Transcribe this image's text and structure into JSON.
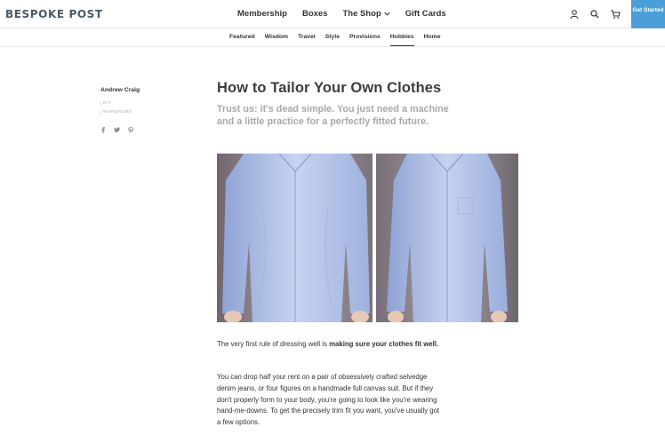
{
  "header": {
    "logo": "BESPOKE POST",
    "nav": [
      {
        "label": "Membership"
      },
      {
        "label": "Boxes"
      },
      {
        "label": "The Shop"
      },
      {
        "label": "Gift Cards"
      }
    ],
    "icons": [
      "user-icon",
      "search-icon",
      "cart-icon"
    ],
    "cta": "Get Started",
    "cta_color": "#4a9fd8"
  },
  "subnav": {
    "items": [
      "Featured",
      "Wisdom",
      "Travel",
      "Style",
      "Provisions",
      "Hobbies",
      "Home"
    ],
    "active": "Hobbies"
  },
  "sidebar": {
    "author": "Andrew Craig",
    "tags": [
      "DIY",
      "WARDROBE"
    ],
    "share_icons": [
      "facebook-icon",
      "twitter-icon",
      "pinterest-icon"
    ]
  },
  "article": {
    "title": "How to Tailor Your Own Clothes",
    "subtitle": "Trust us: it's dead simple. You just need a machine and a little practice for a perfectly fitted future.",
    "para1_lead": "The very first rule of dressing well is ",
    "para1_bold": "making sure your clothes fit well.",
    "para2": "You can drop half your rent on a pair of obsessively crafted selvedge denim jeans, or four figures on a handmade full canvas suit. But if they don't properly form to your body, you're going to look like you're wearing hand-me-downs. To get the precisely trim fit you want, you've usually got a few options."
  }
}
